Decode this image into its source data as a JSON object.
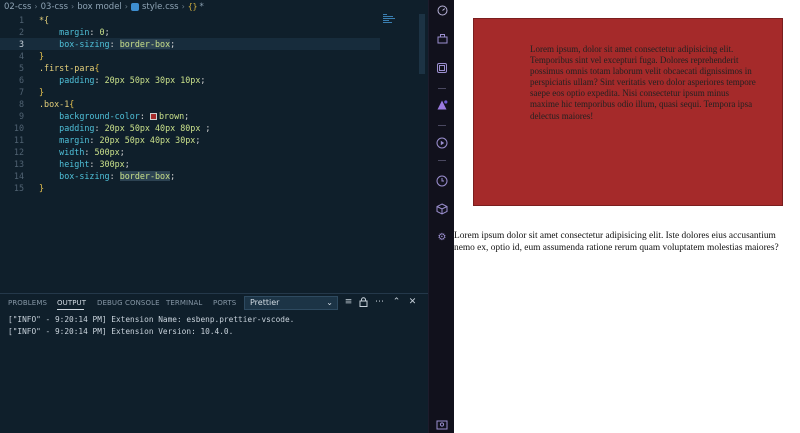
{
  "breadcrumb": {
    "items": [
      "02-css",
      "03-css",
      "box model",
      "style.css"
    ],
    "tail": "*"
  },
  "editor": {
    "active_line": 3,
    "lines": [
      {
        "n": "1",
        "tokens": [
          {
            "t": "*{",
            "c": "t-sel"
          }
        ]
      },
      {
        "n": "2",
        "tokens": [
          {
            "t": "    margin",
            "c": "t-prop"
          },
          {
            "t": ": ",
            "c": "t-plain"
          },
          {
            "t": "0",
            "c": "t-num"
          },
          {
            "t": ";",
            "c": "t-plain"
          }
        ]
      },
      {
        "n": "3",
        "tokens": [
          {
            "t": "    box-sizing",
            "c": "t-prop"
          },
          {
            "t": ": ",
            "c": "t-plain"
          },
          {
            "t": "border-box",
            "c": "t-kw t-hl"
          },
          {
            "t": ";",
            "c": "t-plain"
          }
        ]
      },
      {
        "n": "4",
        "tokens": [
          {
            "t": "}",
            "c": "t-brace"
          }
        ]
      },
      {
        "n": "5",
        "tokens": [
          {
            "t": ".first-para",
            "c": "t-sel"
          },
          {
            "t": "{",
            "c": "t-brace"
          }
        ]
      },
      {
        "n": "6",
        "tokens": [
          {
            "t": "    padding",
            "c": "t-prop"
          },
          {
            "t": ": ",
            "c": "t-plain"
          },
          {
            "t": "20px 50px 30px 10px",
            "c": "t-num"
          },
          {
            "t": ";",
            "c": "t-plain"
          }
        ]
      },
      {
        "n": "7",
        "tokens": [
          {
            "t": "}",
            "c": "t-brace"
          }
        ]
      },
      {
        "n": "8",
        "tokens": [
          {
            "t": ".box-1",
            "c": "t-sel"
          },
          {
            "t": "{",
            "c": "t-brace"
          }
        ]
      },
      {
        "n": "9",
        "tokens": [
          {
            "t": "    background-color",
            "c": "t-prop"
          },
          {
            "t": ": ",
            "c": "t-plain"
          },
          {
            "t": "",
            "c": "swatch"
          },
          {
            "t": "brown",
            "c": "t-kw"
          },
          {
            "t": ";",
            "c": "t-plain"
          }
        ]
      },
      {
        "n": "10",
        "tokens": [
          {
            "t": "    padding",
            "c": "t-prop"
          },
          {
            "t": ": ",
            "c": "t-plain"
          },
          {
            "t": "20px 50px 40px 80px",
            "c": "t-num"
          },
          {
            "t": " ;",
            "c": "t-plain"
          }
        ]
      },
      {
        "n": "11",
        "tokens": [
          {
            "t": "    margin",
            "c": "t-prop"
          },
          {
            "t": ": ",
            "c": "t-plain"
          },
          {
            "t": "20px 50px 40px 30px",
            "c": "t-num"
          },
          {
            "t": ";",
            "c": "t-plain"
          }
        ]
      },
      {
        "n": "12",
        "tokens": [
          {
            "t": "    width",
            "c": "t-prop"
          },
          {
            "t": ": ",
            "c": "t-plain"
          },
          {
            "t": "500px",
            "c": "t-num"
          },
          {
            "t": ";",
            "c": "t-plain"
          }
        ]
      },
      {
        "n": "13",
        "tokens": [
          {
            "t": "    height",
            "c": "t-prop"
          },
          {
            "t": ": ",
            "c": "t-plain"
          },
          {
            "t": "300px",
            "c": "t-num"
          },
          {
            "t": ";",
            "c": "t-plain"
          }
        ]
      },
      {
        "n": "14",
        "tokens": [
          {
            "t": "    box-sizing",
            "c": "t-prop"
          },
          {
            "t": ": ",
            "c": "t-plain"
          },
          {
            "t": "border-box",
            "c": "t-kw t-hl"
          },
          {
            "t": ";",
            "c": "t-plain"
          }
        ]
      },
      {
        "n": "15",
        "tokens": [
          {
            "t": "}",
            "c": "t-brace"
          }
        ]
      }
    ]
  },
  "panel": {
    "tabs": [
      "PROBLEMS",
      "OUTPUT",
      "DEBUG CONSOLE",
      "TERMINAL",
      "PORTS"
    ],
    "active_tab": "OUTPUT",
    "output_channel": "Prettier",
    "logs": [
      "[\"INFO\" - 9:20:14 PM] Extension Name: esbenp.prettier-vscode.",
      "[\"INFO\" - 9:20:14 PM] Extension Version: 10.4.0."
    ]
  },
  "preview": {
    "box_text": "Lorem ipsum, dolor sit amet consectetur adipisicing elit. Temporibus sint vel excepturi fuga. Dolores reprehenderit possimus omnis totam laborum velit obcaecati dignissimos in perspiciatis ullam? Sint veritatis vero dolor asperiores tempore saepe eos optio expedita. Nisi consectetur ipsum minus maxime hic temporibus odio illum, quasi sequi. Tempora ipsa delectus maiores!",
    "para_line_1": "Lorem ipsum dolor sit amet consectetur adipisicing elit. Iste dolores eius accusantium",
    "para_line_2": "nemo ex, optio id, eum assumenda ratione rerum quam voluptatem molestias maiores?",
    "box_color": "#a52a2a"
  }
}
